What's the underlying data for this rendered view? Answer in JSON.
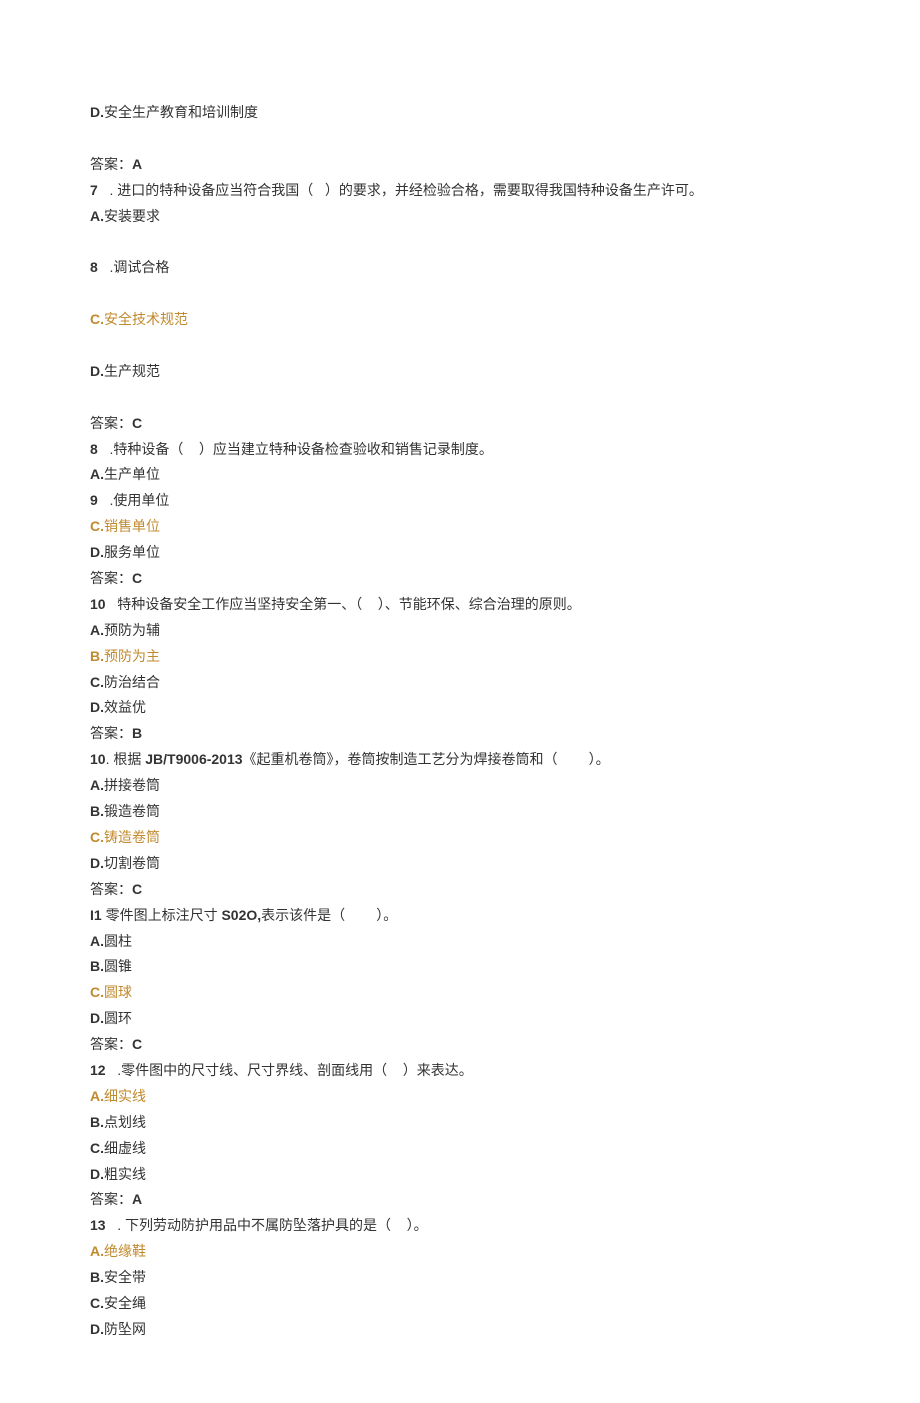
{
  "lines": [
    {
      "segments": [
        {
          "text": "D.",
          "bold": true
        },
        {
          "text": "安全生产教育和培训制度"
        }
      ]
    },
    {
      "segments": [
        {
          "text": " "
        }
      ]
    },
    {
      "segments": [
        {
          "text": "答案："
        },
        {
          "text": "A",
          "bold": true
        }
      ]
    },
    {
      "segments": [
        {
          "text": "7",
          "bold": true
        },
        {
          "text": "   . 进口的特种设备应当符合我国（   ）的要求，并经检验合格，需要取得我国特种设备生产许可。"
        }
      ]
    },
    {
      "segments": [
        {
          "text": "A.",
          "bold": true
        },
        {
          "text": "安装要求"
        }
      ]
    },
    {
      "segments": [
        {
          "text": " "
        }
      ]
    },
    {
      "segments": [
        {
          "text": "8",
          "bold": true
        },
        {
          "text": "   .调试合格"
        }
      ]
    },
    {
      "segments": [
        {
          "text": " "
        }
      ]
    },
    {
      "segments": [
        {
          "text": "C.",
          "bold": true,
          "highlight": true
        },
        {
          "text": "安全技术规范",
          "highlight": true
        }
      ]
    },
    {
      "segments": [
        {
          "text": " "
        }
      ]
    },
    {
      "segments": [
        {
          "text": "D.",
          "bold": true
        },
        {
          "text": "生产规范"
        }
      ]
    },
    {
      "segments": [
        {
          "text": " "
        }
      ]
    },
    {
      "segments": [
        {
          "text": "答案："
        },
        {
          "text": "C",
          "bold": true
        }
      ]
    },
    {
      "segments": [
        {
          "text": "8",
          "bold": true
        },
        {
          "text": "   .特种设备（    ）应当建立特种设备检查验收和销售记录制度。"
        }
      ]
    },
    {
      "segments": [
        {
          "text": "A.",
          "bold": true
        },
        {
          "text": "生产单位"
        }
      ]
    },
    {
      "segments": [
        {
          "text": "9",
          "bold": true
        },
        {
          "text": "   .使用单位"
        }
      ]
    },
    {
      "segments": [
        {
          "text": "C.",
          "bold": true,
          "highlight": true
        },
        {
          "text": "销售单位",
          "highlight": true
        }
      ]
    },
    {
      "segments": [
        {
          "text": "D.",
          "bold": true
        },
        {
          "text": "服务单位"
        }
      ]
    },
    {
      "segments": [
        {
          "text": "答案："
        },
        {
          "text": "C",
          "bold": true
        }
      ]
    },
    {
      "segments": [
        {
          "text": "10",
          "bold": true
        },
        {
          "text": "   特种设备安全工作应当坚持安全第一、（    ）、节能环保、综合治理的原则。"
        }
      ]
    },
    {
      "segments": [
        {
          "text": "A.",
          "bold": true
        },
        {
          "text": "预防为辅"
        }
      ]
    },
    {
      "segments": [
        {
          "text": "B.",
          "bold": true,
          "highlight": true
        },
        {
          "text": "预防为主",
          "highlight": true
        }
      ]
    },
    {
      "segments": [
        {
          "text": "C.",
          "bold": true
        },
        {
          "text": "防治结合"
        }
      ]
    },
    {
      "segments": [
        {
          "text": "D.",
          "bold": true
        },
        {
          "text": "效益优"
        }
      ]
    },
    {
      "segments": [
        {
          "text": "答案："
        },
        {
          "text": "B",
          "bold": true
        }
      ]
    },
    {
      "segments": [
        {
          "text": "10",
          "bold": true
        },
        {
          "text": ". 根据 "
        },
        {
          "text": "JB/T9006-2013",
          "bold": true
        },
        {
          "text": "《起重机卷筒》，卷筒按制造工艺分为焊接卷筒和（        ）。"
        }
      ]
    },
    {
      "segments": [
        {
          "text": "A.",
          "bold": true
        },
        {
          "text": "拼接卷筒"
        }
      ]
    },
    {
      "segments": [
        {
          "text": "B.",
          "bold": true
        },
        {
          "text": "锻造卷筒"
        }
      ]
    },
    {
      "segments": [
        {
          "text": "C.",
          "bold": true,
          "highlight": true
        },
        {
          "text": "铸造卷筒",
          "highlight": true
        }
      ]
    },
    {
      "segments": [
        {
          "text": "D.",
          "bold": true
        },
        {
          "text": "切割卷筒"
        }
      ]
    },
    {
      "segments": [
        {
          "text": "答案："
        },
        {
          "text": "C",
          "bold": true
        }
      ]
    },
    {
      "segments": [
        {
          "text": "I1 ",
          "bold": true
        },
        {
          "text": "零件图上标注尺寸 "
        },
        {
          "text": "S02O,",
          "bold": true
        },
        {
          "text": "表示该件是（        ）。"
        }
      ]
    },
    {
      "segments": [
        {
          "text": "A.",
          "bold": true
        },
        {
          "text": "圆柱"
        }
      ]
    },
    {
      "segments": [
        {
          "text": "B.",
          "bold": true
        },
        {
          "text": "圆锥"
        }
      ]
    },
    {
      "segments": [
        {
          "text": "C.",
          "bold": true,
          "highlight": true
        },
        {
          "text": "圆球",
          "highlight": true
        }
      ]
    },
    {
      "segments": [
        {
          "text": "D.",
          "bold": true
        },
        {
          "text": "圆环"
        }
      ]
    },
    {
      "segments": [
        {
          "text": "答案："
        },
        {
          "text": "C",
          "bold": true
        }
      ]
    },
    {
      "segments": [
        {
          "text": "12",
          "bold": true
        },
        {
          "text": "   .零件图中的尺寸线、尺寸界线、剖面线用（    ）来表达。"
        }
      ]
    },
    {
      "segments": [
        {
          "text": "A.",
          "bold": true,
          "highlight": true
        },
        {
          "text": "细实线",
          "highlight": true
        }
      ]
    },
    {
      "segments": [
        {
          "text": "B.",
          "bold": true
        },
        {
          "text": "点划线"
        }
      ]
    },
    {
      "segments": [
        {
          "text": "C.",
          "bold": true
        },
        {
          "text": "细虚线"
        }
      ]
    },
    {
      "segments": [
        {
          "text": "D.",
          "bold": true
        },
        {
          "text": "粗实线"
        }
      ]
    },
    {
      "segments": [
        {
          "text": "答案："
        },
        {
          "text": "A",
          "bold": true
        }
      ]
    },
    {
      "segments": [
        {
          "text": "13",
          "bold": true
        },
        {
          "text": "   . 下列劳动防护用品中不属防坠落护具的是（    ）。"
        }
      ]
    },
    {
      "segments": [
        {
          "text": "A.",
          "bold": true,
          "highlight": true
        },
        {
          "text": "绝缘鞋",
          "highlight": true
        }
      ]
    },
    {
      "segments": [
        {
          "text": "B.",
          "bold": true
        },
        {
          "text": "安全带"
        }
      ]
    },
    {
      "segments": [
        {
          "text": "C.",
          "bold": true
        },
        {
          "text": "安全绳"
        }
      ]
    },
    {
      "segments": [
        {
          "text": "D.",
          "bold": true
        },
        {
          "text": "防坠网"
        }
      ]
    }
  ]
}
